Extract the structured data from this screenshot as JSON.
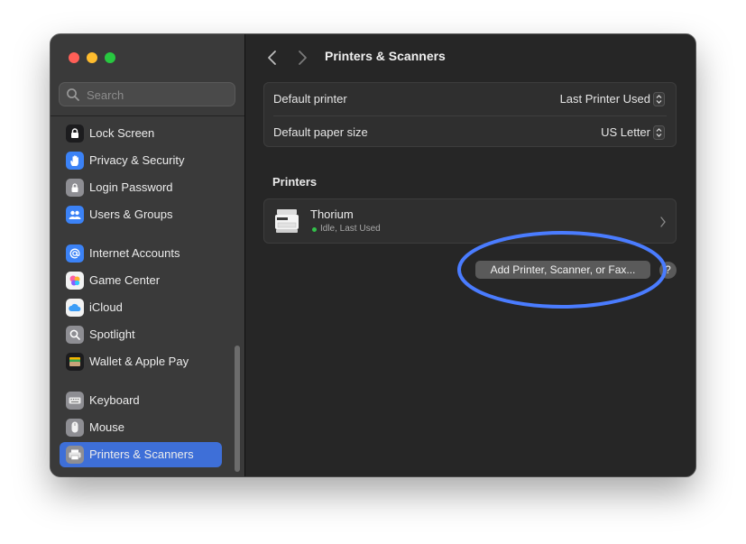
{
  "sidebar": {
    "search_placeholder": "Search",
    "items": [
      {
        "label": "Lock Screen",
        "icon": "lock-icon"
      },
      {
        "label": "Privacy & Security",
        "icon": "hand-icon"
      },
      {
        "label": "Login Password",
        "icon": "padlock-icon"
      },
      {
        "label": "Users & Groups",
        "icon": "users-icon"
      },
      {
        "label": "Internet Accounts",
        "icon": "at-sign-icon"
      },
      {
        "label": "Game Center",
        "icon": "game-center-icon"
      },
      {
        "label": "iCloud",
        "icon": "cloud-icon"
      },
      {
        "label": "Spotlight",
        "icon": "magnifier-icon"
      },
      {
        "label": "Wallet & Apple Pay",
        "icon": "wallet-icon"
      },
      {
        "label": "Keyboard",
        "icon": "keyboard-icon"
      },
      {
        "label": "Mouse",
        "icon": "mouse-icon"
      },
      {
        "label": "Printers & Scanners",
        "icon": "printer-icon",
        "selected": true
      }
    ]
  },
  "main": {
    "title": "Printers & Scanners",
    "settings": {
      "default_printer_label": "Default printer",
      "default_printer_value": "Last Printer Used",
      "paper_size_label": "Default paper size",
      "paper_size_value": "US Letter"
    },
    "printers_section": "Printers",
    "printer": {
      "name": "Thorium",
      "status": "Idle, Last Used"
    },
    "add_button": "Add Printer, Scanner, or Fax...",
    "help_button": "?"
  },
  "colors": {
    "accent": "#3e6fd8",
    "highlight_ring": "#4a7cff",
    "status_ok": "#32c14a"
  }
}
